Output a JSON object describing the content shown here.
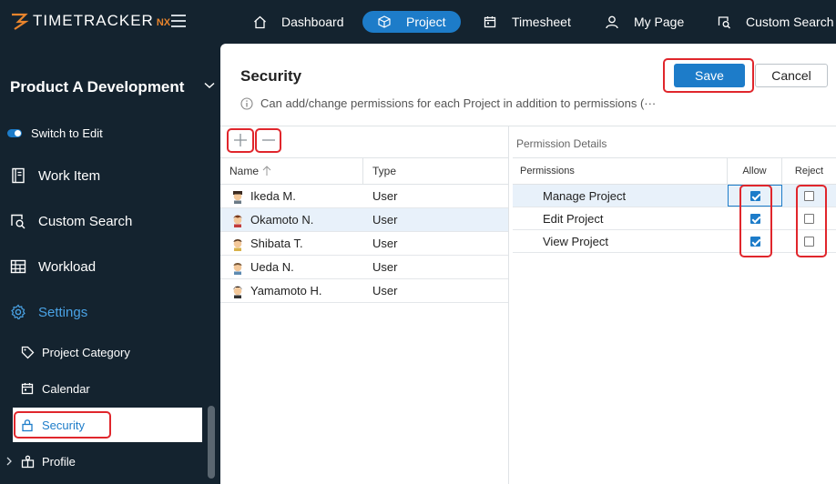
{
  "app": {
    "logo_text": "TIMETRACKER",
    "logo_suffix": "NX"
  },
  "topnav": [
    {
      "label": "Dashboard",
      "icon": "home-icon",
      "active": false
    },
    {
      "label": "Project",
      "icon": "cube-icon",
      "active": true
    },
    {
      "label": "Timesheet",
      "icon": "calendar-icon",
      "active": false
    },
    {
      "label": "My Page",
      "icon": "user-icon",
      "active": false
    },
    {
      "label": "Custom Search",
      "icon": "search-doc-icon",
      "active": false
    }
  ],
  "sidebar": {
    "project_title": "Product A Development",
    "switch_label": "Switch to Edit",
    "items": [
      {
        "label": "Work Item",
        "icon": "book-icon"
      },
      {
        "label": "Custom Search",
        "icon": "search-doc-icon"
      },
      {
        "label": "Workload",
        "icon": "grid-icon"
      },
      {
        "label": "Settings",
        "icon": "gear-icon",
        "active": true
      }
    ],
    "subitems": [
      {
        "label": "Project Category",
        "icon": "tag-icon"
      },
      {
        "label": "Calendar",
        "icon": "calendar-icon"
      },
      {
        "label": "Security",
        "icon": "lock-icon",
        "active": true
      },
      {
        "label": "Profile",
        "icon": "profile-icon"
      }
    ],
    "accent_color": "#1d7cc9"
  },
  "main": {
    "title": "Security",
    "info_text": "Can add/change permissions for each Project in addition to permissions (···",
    "save_label": "Save",
    "cancel_label": "Cancel",
    "users_table": {
      "headers": {
        "name": "Name",
        "type": "Type"
      },
      "rows": [
        {
          "name": "Ikeda M.",
          "type": "User",
          "selected": false
        },
        {
          "name": "Okamoto N.",
          "type": "User",
          "selected": true
        },
        {
          "name": "Shibata T.",
          "type": "User",
          "selected": false
        },
        {
          "name": "Ueda N.",
          "type": "User",
          "selected": false
        },
        {
          "name": "Yamamoto H.",
          "type": "User",
          "selected": false
        }
      ]
    },
    "permissions": {
      "caption": "Permission Details",
      "headers": {
        "permissions": "Permissions",
        "allow": "Allow",
        "reject": "Reject"
      },
      "rows": [
        {
          "label": "Manage Project",
          "allow": true,
          "reject": false
        },
        {
          "label": "Edit Project",
          "allow": true,
          "reject": false
        },
        {
          "label": "View Project",
          "allow": true,
          "reject": false
        }
      ]
    }
  }
}
